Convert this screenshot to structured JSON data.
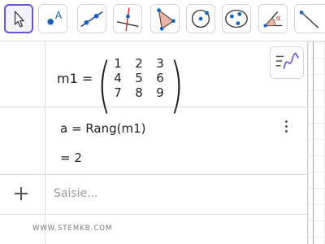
{
  "toolbar": {
    "tools": [
      {
        "name": "move",
        "icon": "cursor-arrow-icon",
        "selected": true
      },
      {
        "name": "point",
        "icon": "point-icon",
        "selected": false
      },
      {
        "name": "line",
        "icon": "line-through-two-points-icon",
        "selected": false
      },
      {
        "name": "perpendicular",
        "icon": "perpendicular-line-icon",
        "selected": false
      },
      {
        "name": "polygon",
        "icon": "polygon-icon",
        "selected": false
      },
      {
        "name": "circle-center-point",
        "icon": "circle-center-point-icon",
        "selected": false
      },
      {
        "name": "conic",
        "icon": "ellipse-icon",
        "selected": false
      },
      {
        "name": "angle",
        "icon": "angle-icon",
        "selected": false
      },
      {
        "name": "reflect",
        "icon": "reflect-line-icon",
        "selected": false
      }
    ],
    "point_tool_letter": "A",
    "angle_tool_letter": "α"
  },
  "algebra": {
    "m1": {
      "label": "m1 =",
      "matrix": [
        [
          "1",
          "2",
          "3"
        ],
        [
          "4",
          "5",
          "6"
        ],
        [
          "7",
          "8",
          "9"
        ]
      ]
    },
    "a": {
      "definition": "a = Rang(m1)",
      "value": "= 2"
    },
    "input_placeholder": "Saisie..."
  },
  "watermark": "WWW.STEMKB.COM",
  "colors": {
    "accent": "#6557d2",
    "point_blue": "#1565c0",
    "line_blue": "#1a3d8f",
    "perp_red": "#d32f2f",
    "polygon_fill": "#e8b5a8"
  }
}
